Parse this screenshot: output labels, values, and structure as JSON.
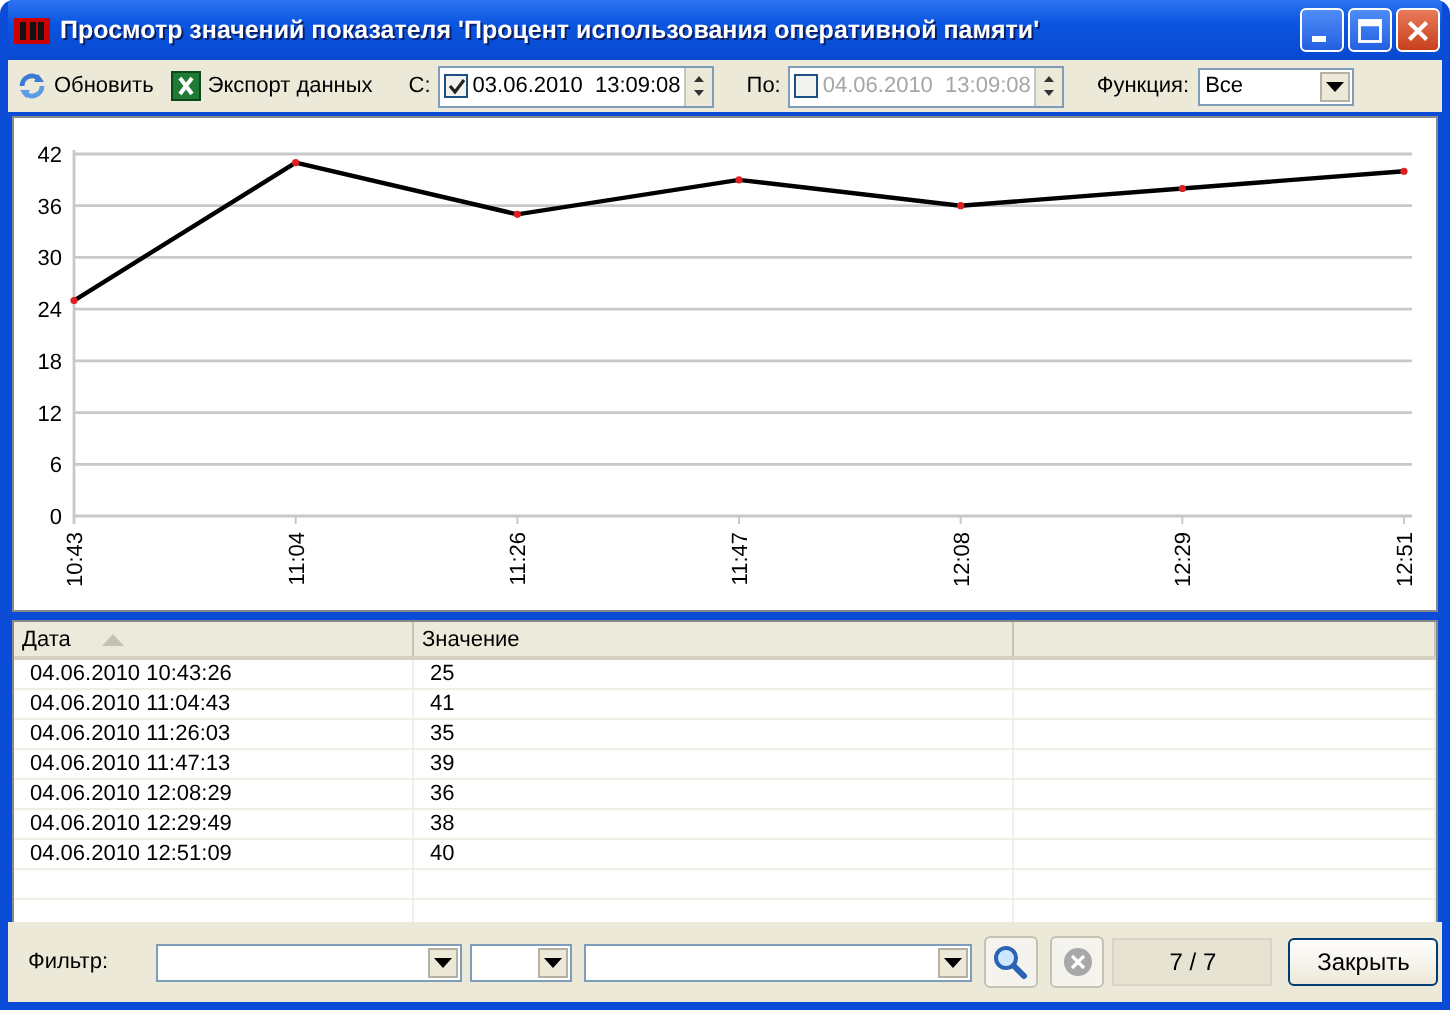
{
  "window": {
    "title": "Просмотр значений показателя 'Процент использования оперативной памяти'"
  },
  "toolbar": {
    "buttons": [
      {
        "label": "Обновить",
        "kind": "refresh"
      },
      {
        "label": "Экспорт данных",
        "kind": "excel"
      }
    ],
    "from": {
      "label": "С:",
      "checked": true,
      "value": "03.06.2010  13:09:08"
    },
    "to": {
      "label": "По:",
      "checked": false,
      "value": "04.06.2010  13:09:08"
    },
    "function": {
      "label": "Функция:",
      "value": "Все"
    }
  },
  "chart": {
    "chart_data": {
      "type": "line",
      "categories": [
        "10:43",
        "11:04",
        "11:26",
        "11:47",
        "12:08",
        "12:29",
        "12:51"
      ],
      "series": [
        {
          "color": "#000000",
          "marker": true,
          "values": [
            25,
            41,
            35,
            39,
            36,
            38,
            40
          ]
        }
      ],
      "grid": true,
      "ylim": [
        0,
        42
      ],
      "yticks": [
        0,
        6,
        12,
        18,
        24,
        30,
        36,
        42
      ]
    }
  },
  "table": {
    "columns": [
      {
        "label": "Дата",
        "sorted": true
      },
      {
        "label": "Значение",
        "sorted": false
      },
      {
        "sorted": false
      }
    ],
    "rows": [
      [
        "04.06.2010 10:43:26",
        "25"
      ],
      [
        "04.06.2010 11:04:43",
        "41"
      ],
      [
        "04.06.2010 11:26:03",
        "35"
      ],
      [
        "04.06.2010 11:47:13",
        "39"
      ],
      [
        "04.06.2010 12:08:29",
        "36"
      ],
      [
        "04.06.2010 12:29:49",
        "38"
      ],
      [
        "04.06.2010 12:51:09",
        "40"
      ]
    ]
  },
  "filter": {
    "label": "Фильтр:",
    "search_disabled": false,
    "clear_disabled": true,
    "count": "7 / 7",
    "close": "Закрыть"
  }
}
